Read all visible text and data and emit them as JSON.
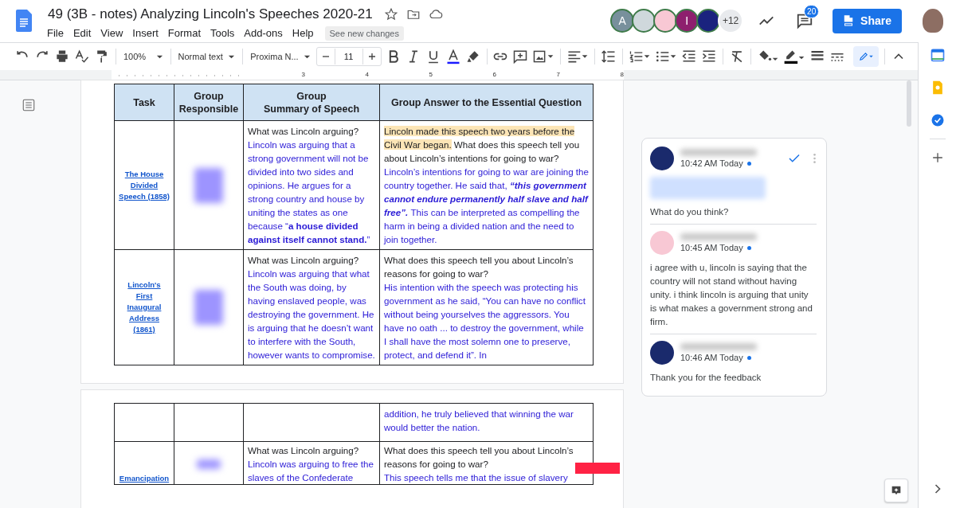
{
  "header": {
    "title": "49 (3B - notes) Analyzing Lincoln's Speeches 2020-21",
    "menus": [
      "File",
      "Edit",
      "View",
      "Insert",
      "Format",
      "Tools",
      "Add-ons",
      "Help"
    ],
    "changes_button": "See new changes",
    "collaborators": [
      {
        "kind": "initial",
        "initial": "A",
        "color": "#78909c"
      },
      {
        "kind": "plain",
        "color": "#cfd8dc"
      },
      {
        "kind": "plain",
        "color": "#f8c8d4"
      },
      {
        "kind": "initial",
        "initial": "I",
        "color": "#8e1f6e"
      },
      {
        "kind": "plain",
        "color": "#1a237e"
      }
    ],
    "more_collaborators": "+12",
    "comment_count": "20",
    "share": "Share"
  },
  "toolbar": {
    "zoom": "100%",
    "style": "Normal text",
    "font": "Proxima N...",
    "font_size": "11"
  },
  "ruler": [
    "3",
    "4",
    "5",
    "6",
    "7",
    "8"
  ],
  "table": {
    "columns": [
      "Task",
      "Group Responsible",
      "Group\nSummary of Speech",
      "Group Answer to the Essential Question"
    ],
    "rows": [
      {
        "task": "The House Divided Speech (1858)",
        "summary": [
          {
            "kind": "question",
            "text": "What was Lincoln arguing?"
          },
          {
            "kind": "answer",
            "text": "Lincoln was arguing that a strong government will not be divided into two sides and opinions. He argues for a strong country and house by uniting the states as one because “**a house divided against itself cannot stand.**”"
          }
        ],
        "answer": [
          {
            "kind": "question",
            "highlight": "Lincoln made this speech two years before the Civil War began.",
            "text": "What does this speech tell you about Lincoln’s intentions for going to war?"
          },
          {
            "kind": "answer",
            "text": "Lincoln’s intentions for going to war are joining the country together. He said that,",
            "emphasis": "“this government cannot endure permanently half slave and half free”.",
            "after": "This can be interpreted as compelling the harm in being a divided nation and the need to join together."
          }
        ]
      },
      {
        "task": "Lincoln's First Inaugural Address (1861)",
        "summary": [
          {
            "kind": "question",
            "text": "What was Lincoln arguing?"
          },
          {
            "kind": "answer",
            "text": "Lincoln was arguing that what the South was doing, by having enslaved people, was destroying the government. He is arguing that he doesn’t want to interfere with the South, however wants to compromise."
          }
        ],
        "answer": [
          {
            "kind": "question",
            "text": "What does this speech tell you about Lincoln’s reasons for going to war?"
          },
          {
            "kind": "answer",
            "text": "His intention with the speech was protecting his government as he said, “You can have no conflict without being yourselves the aggressors. You have no oath ... to destroy the government, while I shall have the most solemn one to preserve, protect, and defend it”. In"
          }
        ]
      }
    ],
    "next_page_rows": [
      {
        "answer": [
          {
            "kind": "answer",
            "text": "addition, he truly believed that winning the war would better the nation."
          }
        ]
      },
      {
        "task": "Emancipation",
        "summary": [
          {
            "kind": "question",
            "text": "What was Lincoln arguing?"
          },
          {
            "kind": "answer",
            "text": "Lincoln was arguing to free the slaves of the Confederate"
          }
        ],
        "answer": [
          {
            "kind": "question",
            "text": "What does this speech tell you about Lincoln’s reasons for going to war?"
          },
          {
            "kind": "answer",
            "text": "This speech tells me that the issue of slavery"
          }
        ]
      }
    ]
  },
  "comments": [
    {
      "time": "10:42 AM Today",
      "unread": true,
      "color": "#1a2a6c",
      "quoted": true,
      "text": "What do you think?"
    },
    {
      "time": "10:45 AM Today",
      "unread": true,
      "color": "#f8c8d4",
      "quoted": false,
      "text": "i agree with u, lincoln is saying that the country will not stand without having unity. i think lincoln is arguing that unity is what makes a government strong and firm."
    },
    {
      "time": "10:46 AM Today",
      "unread": true,
      "color": "#1a2a6c",
      "quoted": false,
      "text": "Thank you for the feedback"
    }
  ]
}
